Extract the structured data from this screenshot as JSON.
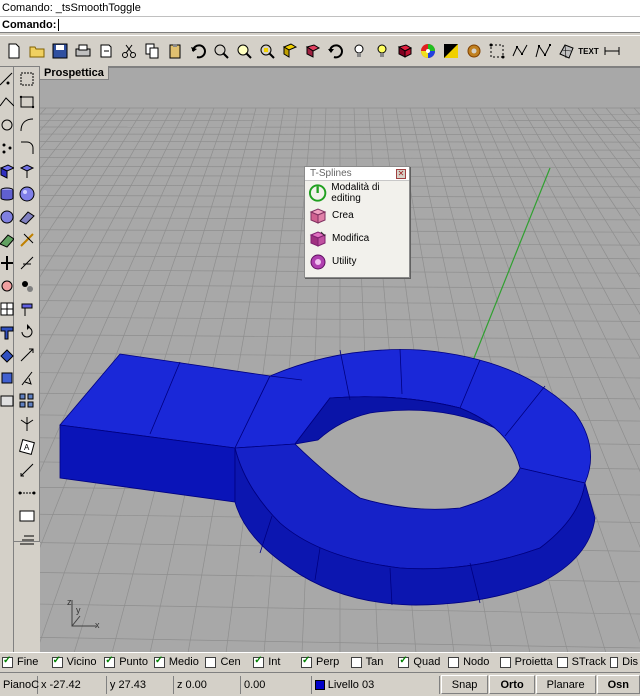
{
  "command": {
    "history": "Comando: _tsSmoothToggle",
    "prompt_label": "Comando:",
    "input_value": ""
  },
  "toolbar_top": {
    "icons": [
      "new-file-icon",
      "open-folder-icon",
      "save-icon",
      "print-icon",
      "import-icon",
      "cut-icon",
      "copy-icon",
      "paste-icon",
      "undo-icon",
      "zoom-window-icon",
      "zoom-extents-icon",
      "zoom-selected-icon",
      "named-views-icon",
      "shade-icon",
      "rotate-view-icon",
      "light-icon",
      "lightbulb-icon",
      "render-icon",
      "color-wheel-icon",
      "material-icon",
      "gear-icon",
      "snap-grid-icon",
      "curve-edit-icon",
      "control-points-icon",
      "mesh-icon",
      "text-icon",
      "dimension-icon"
    ],
    "text_button": "TEXT"
  },
  "viewport": {
    "title": "Prospettica",
    "axis_x": "x",
    "axis_y": "y",
    "axis_z": "z",
    "grid_color": "#8e8e8e",
    "background": "#a8a8a8",
    "object_color": "#0a14c8"
  },
  "tsplines": {
    "title": "T-Splines",
    "items": [
      {
        "label": "Modalità di editing",
        "icon": "power-icon"
      },
      {
        "label": "Crea",
        "icon": "create-cube-icon"
      },
      {
        "label": "Modifica",
        "icon": "modify-cube-icon"
      },
      {
        "label": "Utility",
        "icon": "utility-gear-icon"
      }
    ]
  },
  "osnaps": [
    {
      "label": "Fine",
      "checked": true
    },
    {
      "label": "Vicino",
      "checked": true
    },
    {
      "label": "Punto",
      "checked": true
    },
    {
      "label": "Medio",
      "checked": true
    },
    {
      "label": "Cen",
      "checked": false
    },
    {
      "label": "Int",
      "checked": true
    },
    {
      "label": "Perp",
      "checked": true
    },
    {
      "label": "Tan",
      "checked": false
    },
    {
      "label": "Quad",
      "checked": true
    },
    {
      "label": "Nodo",
      "checked": false
    },
    {
      "label": "Proietta",
      "checked": false
    },
    {
      "label": "STrack",
      "checked": false
    },
    {
      "label": "Dis",
      "checked": false
    }
  ],
  "status": {
    "cplane": "PianoC",
    "x": "x -27.42",
    "y": "y 27.43",
    "z": "z 0.00",
    "dist": "0.00",
    "layer": "Livello 03",
    "layer_color": "#0000c8",
    "snap": "Snap",
    "ortho": "Orto",
    "planar": "Planare",
    "osnap": "Osn"
  }
}
